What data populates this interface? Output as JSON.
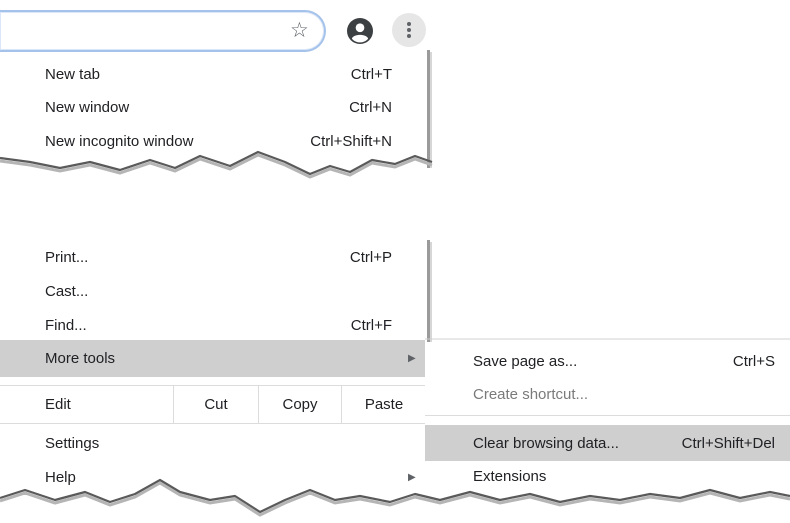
{
  "toolbar": {
    "bookmark_icon": "star-outline-icon",
    "profile_icon": "account-circle-icon",
    "menu_icon": "vertical-dots-icon"
  },
  "main_menu_top": [
    {
      "label": "New tab",
      "shortcut": "Ctrl+T"
    },
    {
      "label": "New window",
      "shortcut": "Ctrl+N"
    },
    {
      "label": "New incognito window",
      "shortcut": "Ctrl+Shift+N"
    }
  ],
  "main_menu_bottom": {
    "print": {
      "label": "Print...",
      "shortcut": "Ctrl+P"
    },
    "cast": {
      "label": "Cast..."
    },
    "find": {
      "label": "Find...",
      "shortcut": "Ctrl+F"
    },
    "more_tools": {
      "label": "More tools",
      "highlighted": true
    },
    "edit": {
      "label": "Edit",
      "cut": "Cut",
      "copy": "Copy",
      "paste": "Paste"
    },
    "settings": {
      "label": "Settings"
    },
    "help": {
      "label": "Help"
    }
  },
  "submenu": {
    "save_page": {
      "label": "Save page as...",
      "shortcut": "Ctrl+S"
    },
    "create_shortcut": {
      "label": "Create shortcut...",
      "disabled": true
    },
    "clear_browsing": {
      "label": "Clear browsing data...",
      "shortcut": "Ctrl+Shift+Del",
      "highlighted": true
    },
    "extensions": {
      "label": "Extensions"
    }
  },
  "colors": {
    "highlight": "#cfcfcf",
    "omnibox_focus": "#a5c2ea",
    "text": "#202124",
    "disabled_text": "#7a7a7a"
  }
}
